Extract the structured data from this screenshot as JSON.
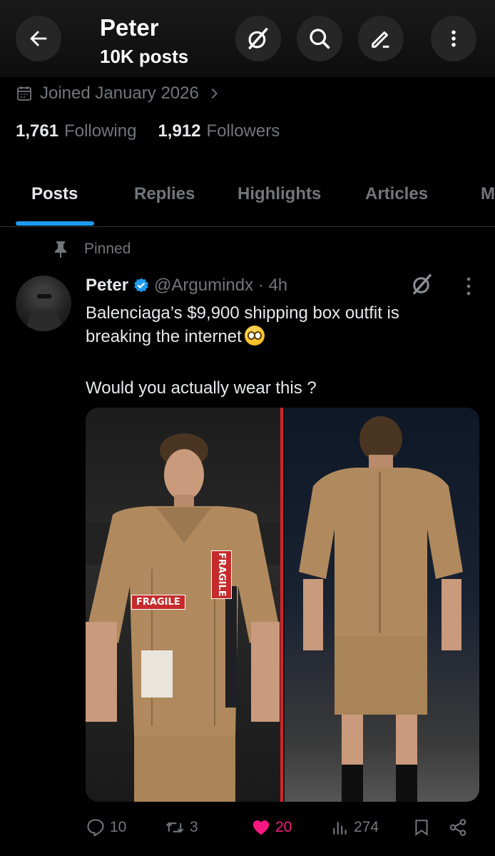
{
  "header": {
    "name": "Peter",
    "post_count": "10K posts"
  },
  "profile": {
    "joined": "Joined January 2026",
    "following_count": "1,761",
    "following_label": "Following",
    "followers_count": "1,912",
    "followers_label": "Followers"
  },
  "tabs": [
    {
      "label": "Posts",
      "active": true
    },
    {
      "label": "Replies",
      "active": false
    },
    {
      "label": "Highlights",
      "active": false
    },
    {
      "label": "Articles",
      "active": false
    },
    {
      "label": "M",
      "active": false
    }
  ],
  "post": {
    "pinned_label": "Pinned",
    "author_name": "Peter",
    "handle_time": "@Argumindx · 4h",
    "text_line1": "Balenciaga’s $9,900 shipping box outfit is breaking the internet",
    "text_line2": "Would you actually wear this ?",
    "image_labels": {
      "fragile_1": "FRAGILE",
      "fragile_2": "FRAGILE"
    },
    "stats": {
      "replies": "10",
      "reposts": "3",
      "likes": "20",
      "views": "274"
    }
  },
  "colors": {
    "accent": "#1d9bf0",
    "like": "#f91880",
    "muted": "#71767b",
    "text": "#e7e9ea",
    "divider_red": "#d3242b"
  },
  "icons": [
    "back-arrow-icon",
    "grok-icon",
    "search-icon",
    "edit-icon",
    "more-vertical-icon",
    "calendar-icon",
    "chevron-right-icon",
    "pin-icon",
    "verified-badge-icon",
    "reply-icon",
    "repost-icon",
    "heart-icon",
    "views-icon",
    "bookmark-icon",
    "share-icon"
  ]
}
